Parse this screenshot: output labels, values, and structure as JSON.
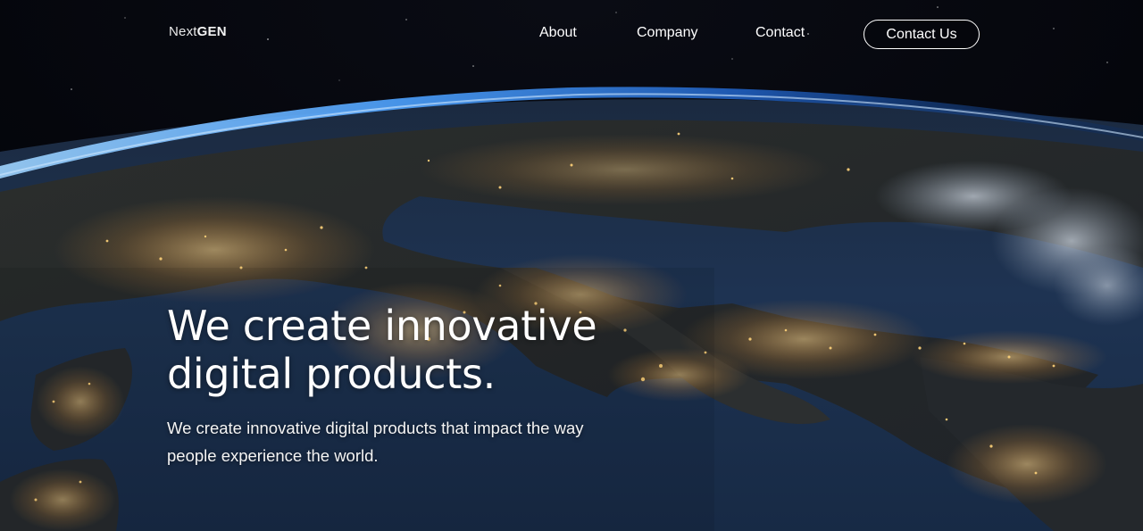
{
  "brand": {
    "light": "Next",
    "bold": "GEN"
  },
  "nav": {
    "items": [
      {
        "label": "About"
      },
      {
        "label": "Company"
      },
      {
        "label": "Contact"
      }
    ],
    "cta_label": "Contact Us"
  },
  "hero": {
    "headline_line1": "We create innovative",
    "headline_line2": "digital products.",
    "subtext_line1": "We create innovative digital products that impact the way",
    "subtext_line2": "people experience the world.",
    "background": "earth-at-night-from-space"
  },
  "colors": {
    "text": "#ffffff",
    "space": "#04060c",
    "ocean": "#1a2e4a",
    "atmosphere": "#3f8df0",
    "city_lights": "#ffc46b"
  }
}
